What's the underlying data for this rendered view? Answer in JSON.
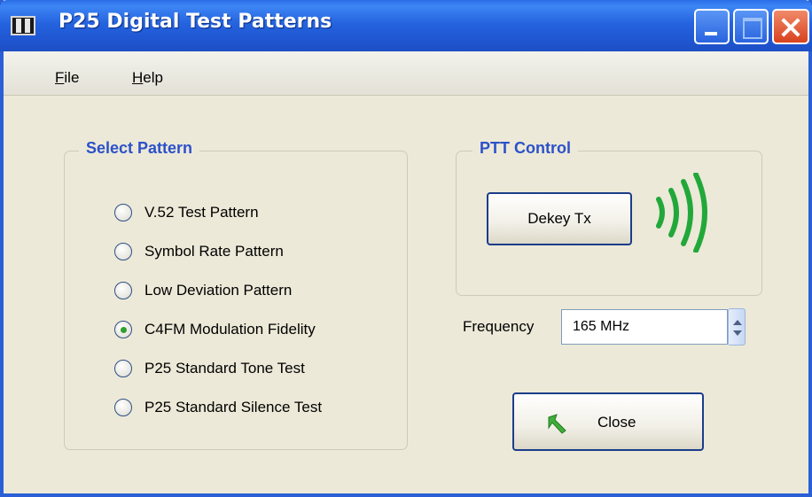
{
  "window": {
    "title": "P25 Digital Test Patterns"
  },
  "menu": {
    "items": [
      {
        "label": "File",
        "mnemonic": "F"
      },
      {
        "label": "Help",
        "mnemonic": "H"
      }
    ]
  },
  "select_pattern": {
    "label": "Select Pattern",
    "options": [
      {
        "label": "V.52 Test Pattern",
        "checked": false
      },
      {
        "label": "Symbol Rate Pattern",
        "checked": false
      },
      {
        "label": "Low Deviation Pattern",
        "checked": false
      },
      {
        "label": "C4FM Modulation Fidelity",
        "checked": true
      },
      {
        "label": "P25 Standard Tone Test",
        "checked": false
      },
      {
        "label": "P25 Standard Silence Test",
        "checked": false
      }
    ]
  },
  "ptt_control": {
    "label": "PTT Control",
    "button_label": "Dekey Tx",
    "signal_icon": "transmit-waves-icon",
    "signal_color": "#22a83a"
  },
  "frequency": {
    "label": "Frequency",
    "value": "165 MHz"
  },
  "close_button": {
    "label": "Close",
    "icon": "exit-arrow-icon",
    "icon_color": "#3fae3a"
  },
  "colors": {
    "titlebar": "#2563df",
    "window_bg": "#ece9d8",
    "group_label": "#2c51c9",
    "button_border": "#1b3d8a"
  }
}
